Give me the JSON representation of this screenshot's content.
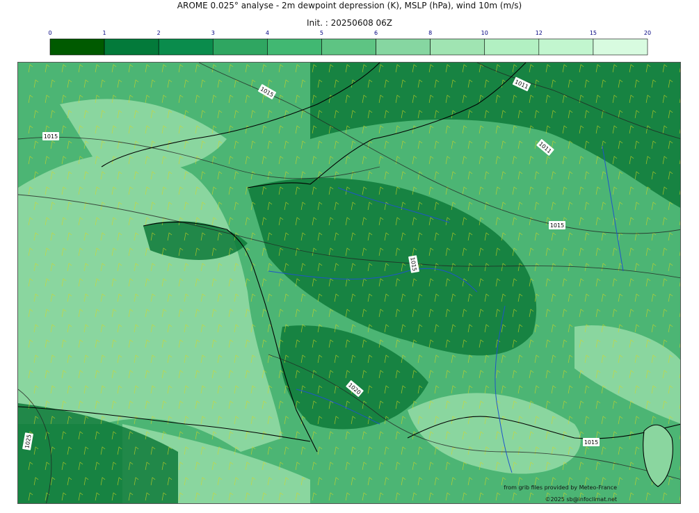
{
  "title": "AROME 0.025° analyse - 2m dewpoint depression (K), MSLP (hPa), wind 10m (m/s)",
  "init": "Init. : 20250608 06Z",
  "colorbar": {
    "ticks": [
      "0",
      "1",
      "2",
      "3",
      "4",
      "5",
      "6",
      "8",
      "10",
      "12",
      "15",
      "20"
    ],
    "colors": [
      "#005a00",
      "#037a3a",
      "#0a8c4c",
      "#2fa661",
      "#41b872",
      "#5ec483",
      "#86d6a1",
      "#a0e4b2",
      "#b2f0c2",
      "#c2f6cf",
      "#d8fbe0"
    ],
    "tick_color": "#000080"
  },
  "map": {
    "isobar_labels": [
      "1015",
      "1015",
      "1011",
      "1011",
      "1015",
      "1015",
      "1020",
      "1025",
      "1015"
    ],
    "colors": {
      "background": "#4cb574",
      "dry": "#8ad69f",
      "moist": "#0e7a39",
      "coast": "#000000",
      "rivers": "#1f55c8",
      "isobars": "#222222",
      "barbs": "#d8d820"
    }
  },
  "credits": {
    "source": "from grib files provided by Meteo-France",
    "copyright": "©2025 sb@infoclimat.net"
  }
}
